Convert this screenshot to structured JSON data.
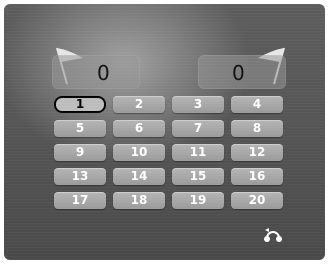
{
  "scoreboard": {
    "left_score": "0",
    "right_score": "0"
  },
  "grid": {
    "buttons": [
      "1",
      "2",
      "3",
      "4",
      "5",
      "6",
      "7",
      "8",
      "9",
      "10",
      "11",
      "12",
      "13",
      "14",
      "15",
      "16",
      "17",
      "18",
      "19",
      "20"
    ],
    "selected_index": 0
  },
  "icons": {
    "left_flag": "flag-icon",
    "right_flag": "flag-icon",
    "bottom_right": "return-control-icon"
  },
  "colors": {
    "background": "#575757",
    "button": "#a6a6a6",
    "score_box": "#969696"
  }
}
